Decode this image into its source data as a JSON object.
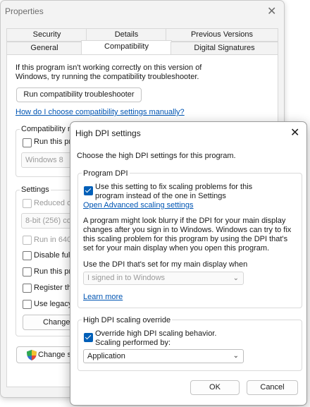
{
  "properties": {
    "title": "Properties",
    "close_glyph": "✕",
    "tabs_row1": [
      "Security",
      "Details",
      "Previous Versions"
    ],
    "tabs_row2": [
      "General",
      "Compatibility",
      "Digital Signatures"
    ],
    "intro": "If this program isn't working correctly on this version of Windows, try running the compatibility troubleshooter.",
    "troubleshooter_button": "Run compatibility troubleshooter",
    "help_link": "How do I choose compatibility settings manually?",
    "compat_mode_group": "Compatibility m",
    "run_compat_label": "Run this pr",
    "os_select": "Windows 8",
    "settings_group": "Settings",
    "reduced_color": "Reduced c",
    "color_select": "8-bit (256) col",
    "run_640": "Run in 640",
    "disable_full": "Disable full",
    "run_this_prog": "Run this pr",
    "register_this": "Register thi",
    "use_legacy": "Use legacy",
    "change_button": "Change",
    "change_settings_button": "Change s",
    "shield_icon": "shield-icon"
  },
  "dpi_dialog": {
    "title": "High DPI settings",
    "close_glyph": "✕",
    "subtitle": "Choose the high DPI settings for this program.",
    "program_dpi_group": "Program DPI",
    "use_setting_label": "Use this setting to fix scaling problems for this program instead of the one in Settings",
    "use_setting_checked": true,
    "advanced_link": "Open Advanced scaling settings",
    "blurry_text": "A program might look blurry if the DPI for your main display changes after you sign in to Windows. Windows can try to fix this scaling problem for this program by using the DPI that's set for your main display when you open this program.",
    "use_dpi_label": "Use the DPI that's set for my main display when",
    "dpi_select": "I signed in to Windows",
    "learn_more": "Learn more",
    "override_group": "High DPI scaling override",
    "override_label": "Override high DPI scaling behavior.",
    "override_checked": true,
    "scaling_by": "Scaling performed by:",
    "scaling_select": "Application",
    "ok": "OK",
    "cancel": "Cancel",
    "accent": "#005fb8",
    "link_color": "#0055b3"
  }
}
